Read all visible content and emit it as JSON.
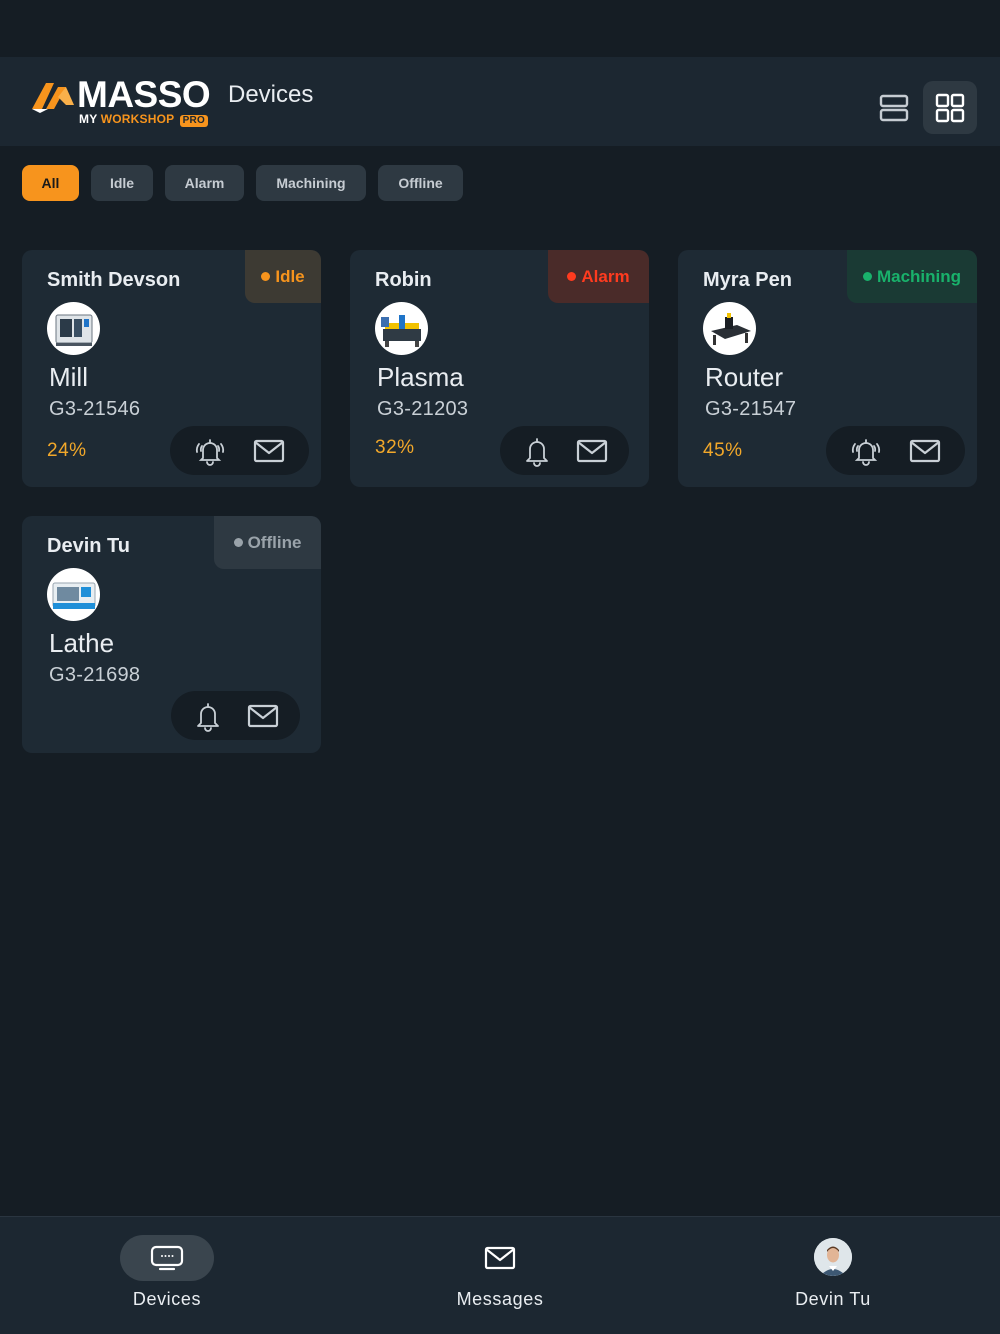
{
  "header": {
    "logo_word": "MASSO",
    "logo_sub_my": "MY",
    "logo_sub_workshop": "WORKSHOP",
    "logo_sub_pro": "PRO",
    "title": "Devices"
  },
  "filters": [
    {
      "label": "All",
      "active": true
    },
    {
      "label": "Idle",
      "active": false
    },
    {
      "label": "Alarm",
      "active": false
    },
    {
      "label": "Machining",
      "active": false
    },
    {
      "label": "Offline",
      "active": false
    }
  ],
  "devices": [
    {
      "owner": "Smith Devson",
      "status": "Idle",
      "status_color": "#f7941d",
      "status_bg": "#3d3a33",
      "type": "Mill",
      "serial": "G3-21546",
      "progress": "24%",
      "alarm_icon": "alarm-ringing-icon"
    },
    {
      "owner": "Robin",
      "status": "Alarm",
      "status_color": "#ff3b1f",
      "status_bg": "#4a2b29",
      "type": "Plasma",
      "serial": "G3-21203",
      "progress": "32%",
      "alarm_icon": "bell-icon"
    },
    {
      "owner": "Myra Pen",
      "status": "Machining",
      "status_color": "#19b16b",
      "status_bg": "#1a3a34",
      "type": "Router",
      "serial": "G3-21547",
      "progress": "45%",
      "alarm_icon": "alarm-ringing-icon"
    },
    {
      "owner": "Devin Tu",
      "status": "Offline",
      "status_color": "#9aa3aa",
      "status_bg": "#2e3942",
      "type": "Lathe",
      "serial": "G3-21698",
      "progress": "",
      "alarm_icon": "bell-icon"
    }
  ],
  "nav": {
    "devices": "Devices",
    "messages": "Messages",
    "profile": "Devin Tu"
  },
  "colors": {
    "accent": "#f7941d",
    "background": "#151d24",
    "card": "#1e2a34"
  }
}
